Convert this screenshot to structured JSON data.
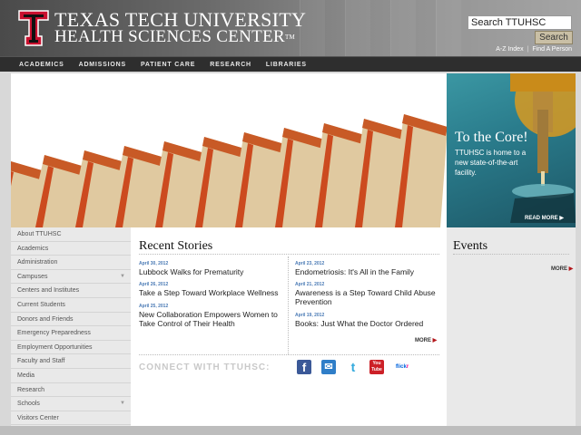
{
  "header": {
    "title_line1": "TEXAS TECH UNIVERSITY",
    "title_line2": "HEALTH SCIENCES CENTER",
    "trademark": "TM",
    "search": {
      "value": "Search TTUHSC",
      "button_label": "Search"
    },
    "util_links": [
      "A-Z Index",
      "Find A Person"
    ]
  },
  "nav": [
    "ACADEMICS",
    "ADMISSIONS",
    "PATIENT CARE",
    "RESEARCH",
    "LIBRARIES"
  ],
  "promo": {
    "title": "To the Core!",
    "text": "TTUHSC is home to a new state-of-the-art facility.",
    "more": "READ MORE"
  },
  "sidebar": [
    {
      "label": "About TTUHSC",
      "expandable": false
    },
    {
      "label": "Academics",
      "expandable": false
    },
    {
      "label": "Administration",
      "expandable": false
    },
    {
      "label": "Campuses",
      "expandable": true
    },
    {
      "label": "Centers and Institutes",
      "expandable": false
    },
    {
      "label": "Current Students",
      "expandable": false
    },
    {
      "label": "Donors and Friends",
      "expandable": false
    },
    {
      "label": "Emergency Preparedness",
      "expandable": false
    },
    {
      "label": "Employment Opportunities",
      "expandable": false
    },
    {
      "label": "Faculty and Staff",
      "expandable": false
    },
    {
      "label": "Media",
      "expandable": false
    },
    {
      "label": "Research",
      "expandable": false
    },
    {
      "label": "Schools",
      "expandable": true
    },
    {
      "label": "Visitors Center",
      "expandable": false
    }
  ],
  "stories": {
    "title": "Recent Stories",
    "left": [
      {
        "date": "April 30, 2012",
        "headline": "Lubbock Walks for Prematurity"
      },
      {
        "date": "April 26, 2012",
        "headline": "Take a Step Toward Workplace Wellness"
      },
      {
        "date": "April 25, 2012",
        "headline": "New Collaboration Empowers Women to Take Control of Their Health"
      }
    ],
    "right": [
      {
        "date": "April 23, 2012",
        "headline": "Endometriosis: It's All in the Family"
      },
      {
        "date": "April 21, 2012",
        "headline": "Awareness is a Step Toward Child Abuse Prevention"
      },
      {
        "date": "April 19, 2012",
        "headline": "Books: Just What the Doctor Ordered"
      }
    ],
    "more": "MORE"
  },
  "connect": {
    "label": "CONNECT WITH TTUHSC:",
    "icons": [
      {
        "name": "facebook-icon",
        "glyph": "f",
        "color": "#3b5998"
      },
      {
        "name": "email-icon",
        "glyph": "✉",
        "color": "#2f7ec8"
      },
      {
        "name": "twitter-icon",
        "glyph": "t",
        "color": "#33aadd"
      },
      {
        "name": "youtube-icon",
        "glyph": "You Tube",
        "color": "#cc2027"
      },
      {
        "name": "flickr-icon",
        "glyph": "flickr",
        "color": "#ffffff"
      }
    ]
  },
  "events": {
    "title": "Events",
    "more": "MORE"
  },
  "colors": {
    "accent_red": "#b3161b",
    "link_blue": "#4a7ab5"
  }
}
